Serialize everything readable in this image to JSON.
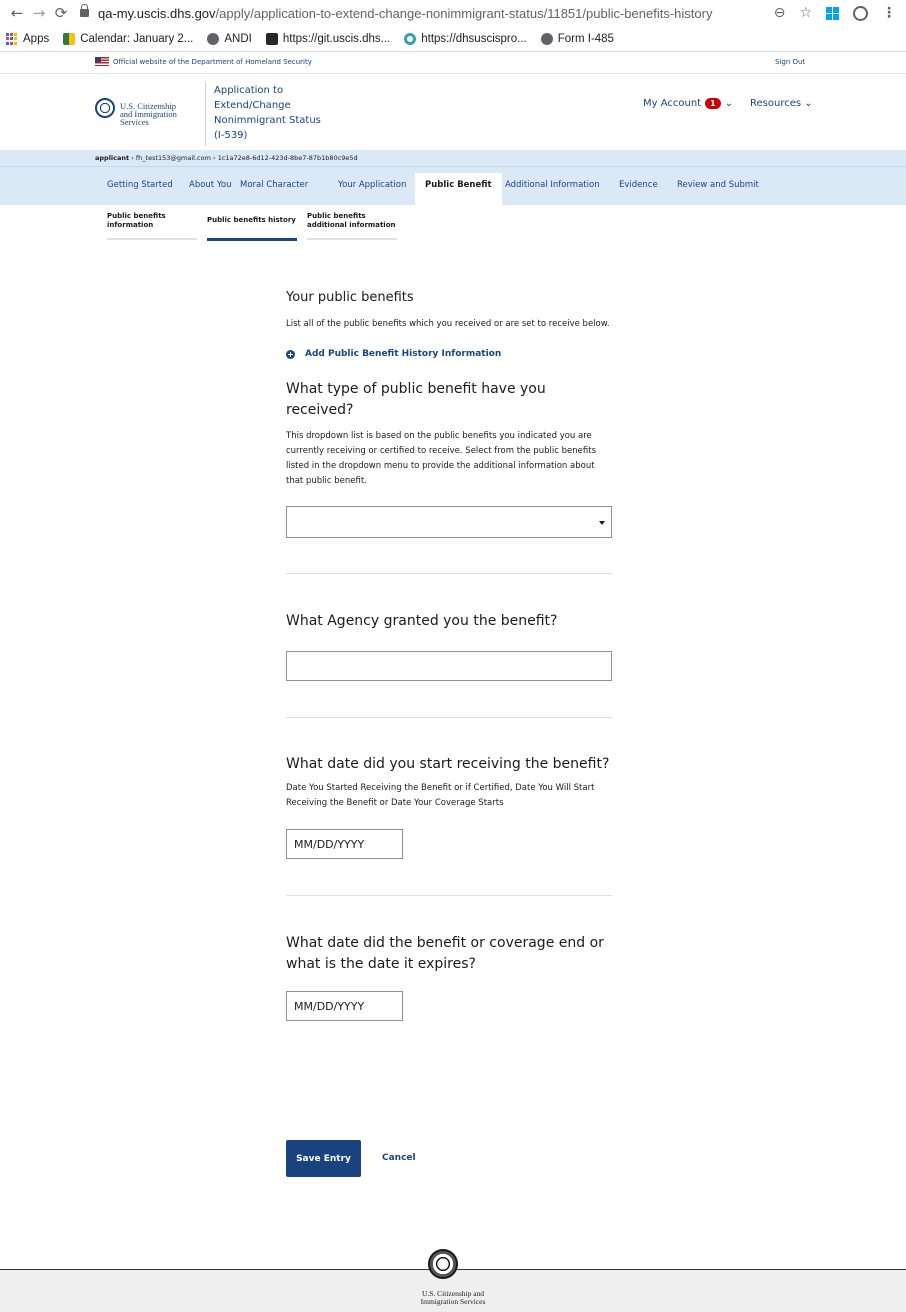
{
  "browser": {
    "url_host": "qa-my.uscis.dhs.gov",
    "url_path": "/apply/application-to-extend-change-nonimmigrant-status/11851/public-benefits-history",
    "bookmarks": [
      "Apps",
      "Calendar: January 2...",
      "ANDI",
      "https://git.uscis.dhs...",
      "https://dhsuscispro...",
      "Form I-485"
    ]
  },
  "banner": {
    "official_text": "Official website of the Department of Homeland Security",
    "sign_out": "Sign Out"
  },
  "header": {
    "agency_lines": [
      "U.S. Citizenship",
      "and Immigration",
      "Services"
    ],
    "app_title": "Application to Extend/Change Nonimmigrant Status (I-539)",
    "my_account": "My Account",
    "notification_count": "1",
    "resources": "Resources"
  },
  "breadcrumb": {
    "role": "applicant",
    "email": "fh_test153@gmail.com",
    "case_id": "1c1a72e8-6d12-423d-8be7-87b1b80c9e5d"
  },
  "nav": {
    "tabs": [
      "Getting Started",
      "About You",
      "Moral Character",
      "Your Application",
      "Public Benefit",
      "Additional Information",
      "Evidence",
      "Review and Submit"
    ],
    "active": "Public Benefit"
  },
  "subtabs": {
    "items": [
      "Public benefits information",
      "Public benefits history",
      "Public benefits additional information"
    ],
    "active": "Public benefits history"
  },
  "main": {
    "section_title": "Your public benefits",
    "section_desc": "List all of the public benefits which you received or are set to receive below.",
    "add_link": "Add Public Benefit History Information",
    "q1_title": "What type of public benefit have you received?",
    "q1_desc": "This dropdown list is based on the public benefits you indicated you are currently receiving or certified to receive. Select from the public benefits listed in the dropdown menu to provide the additional information about that public benefit.",
    "q1_value": "",
    "q2_title": "What Agency granted you the benefit?",
    "q2_value": "",
    "q3_title": "What date did you start receiving the benefit?",
    "q3_desc": "Date You Started Receiving the Benefit or if Certified, Date You Will Start Receiving the Benefit or Date Your Coverage Starts",
    "q3_placeholder": "MM/DD/YYYY",
    "q4_title": "What date did the benefit or coverage end or what is the date it expires?",
    "q4_placeholder": "MM/DD/YYYY",
    "save_label": "Save Entry",
    "cancel_label": "Cancel"
  },
  "footer": {
    "agency_lines": [
      "U.S. Citizenship and",
      "Immigration Services"
    ]
  },
  "colors": {
    "primary": "#1a4480",
    "nav_bg": "#dbe9f7",
    "alert": "#cc0000"
  }
}
